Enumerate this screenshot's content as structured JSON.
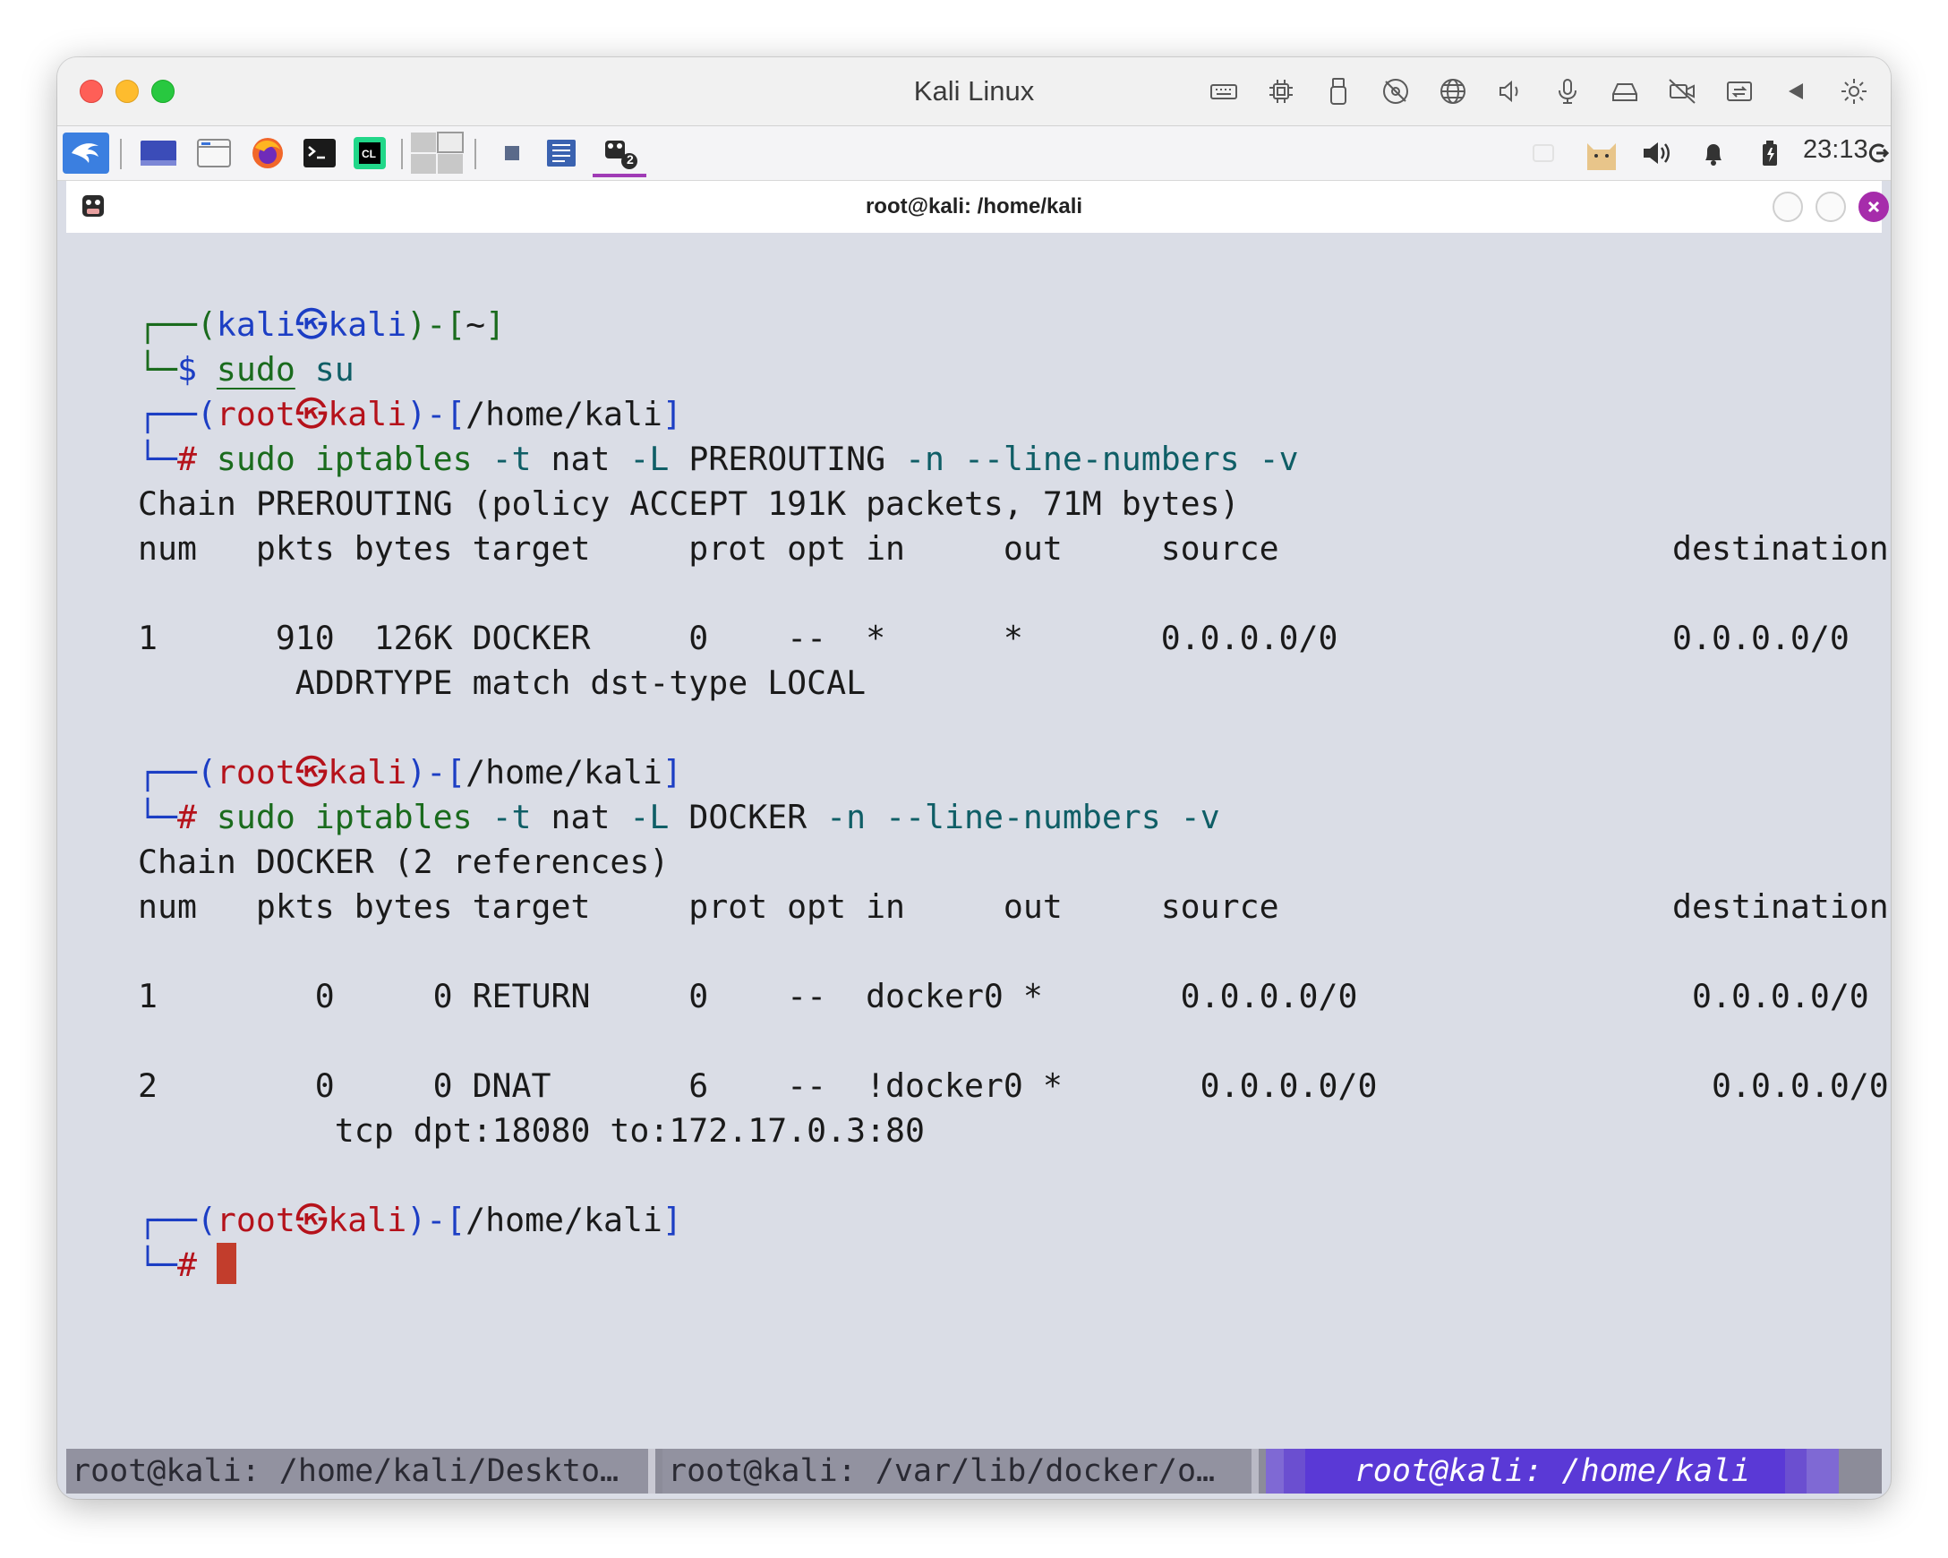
{
  "vm": {
    "title": "Kali Linux",
    "toolbar_icons": [
      "keyboard-icon",
      "cpu-icon",
      "usb-icon",
      "no-disk-icon",
      "network-icon",
      "speaker-icon",
      "microphone-icon",
      "drive-icon",
      "camera-off-icon",
      "shared-folder-icon",
      "back-icon",
      "settings-icon"
    ]
  },
  "panel": {
    "clock": "23:13",
    "workspace_badge": "2"
  },
  "terminal": {
    "title": "root@kali: /home/kali",
    "lines": [
      {
        "segs": [
          [
            "c-green",
            "┌──("
          ],
          [
            "c-blue",
            "kali㉿kali"
          ],
          [
            "c-green",
            ")-["
          ],
          [
            "",
            "~"
          ],
          [
            "c-green",
            "]"
          ]
        ]
      },
      {
        "segs": [
          [
            "c-green",
            "└─"
          ],
          [
            "c-blue",
            "$ "
          ],
          [
            "c-green u",
            "sudo"
          ],
          [
            "c-teal",
            " su"
          ]
        ]
      },
      {
        "segs": [
          [
            "c-blue",
            "┌──("
          ],
          [
            "c-red",
            "root㉿kali"
          ],
          [
            "c-blue",
            ")-["
          ],
          [
            "",
            "/home/kali"
          ],
          [
            "c-blue",
            "]"
          ]
        ]
      },
      {
        "segs": [
          [
            "c-blue",
            "└─"
          ],
          [
            "c-red",
            "# "
          ],
          [
            "c-green",
            "sudo iptables"
          ],
          [
            "c-teal",
            " -t "
          ],
          [
            "",
            "nat"
          ],
          [
            "c-teal",
            " -L "
          ],
          [
            "",
            "PREROUTING"
          ],
          [
            "c-teal",
            " -n --line-numbers -v"
          ]
        ]
      },
      {
        "segs": [
          [
            "",
            "Chain PREROUTING (policy ACCEPT 191K packets, 71M bytes)"
          ]
        ]
      },
      {
        "segs": [
          [
            "",
            "num   pkts bytes target     prot opt in     out     source                    destination"
          ]
        ]
      },
      {
        "segs": [
          [
            "",
            ""
          ]
        ]
      },
      {
        "segs": [
          [
            "",
            "1      910  126K DOCKER     0    --  *      *       0.0.0.0/0                 0.0.0.0/0"
          ]
        ]
      },
      {
        "segs": [
          [
            "",
            "        ADDRTYPE match dst-type LOCAL"
          ]
        ]
      },
      {
        "segs": [
          [
            "",
            ""
          ]
        ]
      },
      {
        "segs": [
          [
            "c-blue",
            "┌──("
          ],
          [
            "c-red",
            "root㉿kali"
          ],
          [
            "c-blue",
            ")-["
          ],
          [
            "",
            "/home/kali"
          ],
          [
            "c-blue",
            "]"
          ]
        ]
      },
      {
        "segs": [
          [
            "c-blue",
            "└─"
          ],
          [
            "c-red",
            "# "
          ],
          [
            "c-green",
            "sudo iptables"
          ],
          [
            "c-teal",
            " -t "
          ],
          [
            "",
            "nat"
          ],
          [
            "c-teal",
            " -L "
          ],
          [
            "",
            "DOCKER"
          ],
          [
            "c-teal",
            " -n --line-numbers -v"
          ]
        ]
      },
      {
        "segs": [
          [
            "",
            "Chain DOCKER (2 references)"
          ]
        ]
      },
      {
        "segs": [
          [
            "",
            "num   pkts bytes target     prot opt in     out     source                    destination"
          ]
        ]
      },
      {
        "segs": [
          [
            "",
            ""
          ]
        ]
      },
      {
        "segs": [
          [
            "",
            "1        0     0 RETURN     0    --  docker0 *       0.0.0.0/0                 0.0.0.0/0"
          ]
        ]
      },
      {
        "segs": [
          [
            "",
            ""
          ]
        ]
      },
      {
        "segs": [
          [
            "",
            "2        0     0 DNAT       6    --  !docker0 *       0.0.0.0/0                 0.0.0.0/0"
          ]
        ]
      },
      {
        "segs": [
          [
            "",
            "          tcp dpt:18080 to:172.17.0.3:80"
          ]
        ]
      },
      {
        "segs": [
          [
            "",
            ""
          ]
        ]
      },
      {
        "segs": [
          [
            "c-blue",
            "┌──("
          ],
          [
            "c-red",
            "root㉿kali"
          ],
          [
            "c-blue",
            ")-["
          ],
          [
            "",
            "/home/kali"
          ],
          [
            "c-blue",
            "]"
          ]
        ]
      },
      {
        "segs": [
          [
            "c-blue",
            "└─"
          ],
          [
            "c-red",
            "# "
          ]
        ],
        "cursor": true
      }
    ]
  },
  "tabs": [
    {
      "label": "root@kali: /home/kali/Deskto…"
    },
    {
      "label": "root@kali: /var/lib/docker/o…"
    },
    {
      "label": "root@kali: /home/kali"
    }
  ]
}
